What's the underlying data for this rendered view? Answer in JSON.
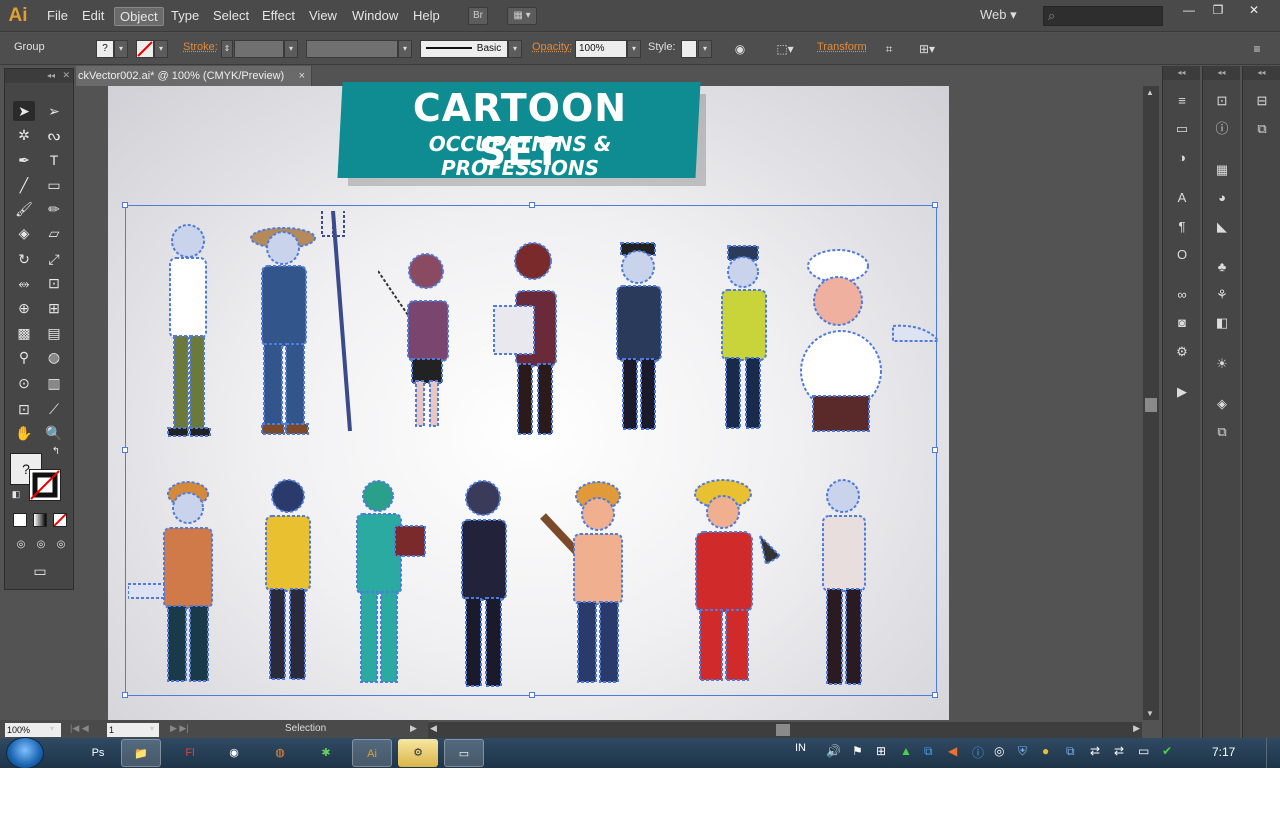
{
  "app": {
    "logo": "Ai",
    "menus": [
      "File",
      "Edit",
      "Object",
      "Type",
      "Select",
      "Effect",
      "View",
      "Window",
      "Help"
    ],
    "active_menu": "Object",
    "bridge_label": "Br",
    "workspace": "Web",
    "search_placeholder": "",
    "accent_selection": "#4f7bdd"
  },
  "control_bar": {
    "selection_type": "Group",
    "stroke_label": "Stroke:",
    "brush_style": "Basic",
    "opacity_label": "Opacity:",
    "opacity_value": "100%",
    "style_label": "Style:",
    "transform_label": "Transform"
  },
  "document": {
    "tab_title": "ckVector002.ai* @ 100% (CMYK/Preview)",
    "tab_close": "×"
  },
  "artwork": {
    "title": "CARTOON SET",
    "subtitle": "OCCUPATIONS & PROFESSIONS",
    "banner_color": "#0e8c92"
  },
  "status_bar": {
    "zoom": "100%",
    "page": "1",
    "tool_status": "Selection"
  },
  "taskbar": {
    "language": "IN",
    "clock": "7:17",
    "apps": [
      "Ps",
      "Explorer",
      "Fl",
      "Chrome",
      "Firefox",
      "Globe",
      "Ai",
      "Utility",
      "Window"
    ]
  }
}
